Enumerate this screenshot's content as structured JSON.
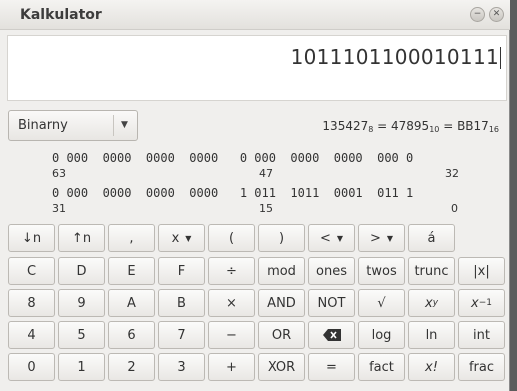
{
  "window": {
    "title": "Kalkulator",
    "minimize_icon": "minimize-icon",
    "close_icon": "close-icon"
  },
  "display": {
    "value": "1011101100010111"
  },
  "mode": {
    "selected": "Binarny"
  },
  "conversion": {
    "oct": "135427",
    "oct_base": "8",
    "dec": "47895",
    "dec_base": "10",
    "hex": "BB17",
    "hex_base": "16"
  },
  "bits": {
    "row1": "0 000  0000  0000  0000   0 000  0000  0000  000 0",
    "row1_left": "63",
    "row1_mid": "47",
    "row1_right": "32",
    "row2": "0 000  0000  0000  0000   1 011  1011  0001  011 1",
    "row2_left": "31",
    "row2_mid": "15",
    "row2_right": "0"
  },
  "keys": {
    "row1": [
      "↓n",
      "↑n",
      ",",
      "x",
      "(",
      ")",
      "<",
      ">",
      "á"
    ],
    "row2": [
      "C",
      "D",
      "E",
      "F",
      "÷",
      "mod",
      "ones",
      "twos",
      "trunc",
      "|x|"
    ],
    "row3": [
      "8",
      "9",
      "A",
      "B",
      "×",
      "AND",
      "NOT",
      "√",
      "x",
      "x"
    ],
    "row3_sup": {
      "pow": "y",
      "inv": "−1"
    },
    "row4": [
      "4",
      "5",
      "6",
      "7",
      "−",
      "OR",
      "",
      "log",
      "ln",
      "int"
    ],
    "row5": [
      "0",
      "1",
      "2",
      "3",
      "+",
      "XOR",
      "=",
      "fact",
      "x!",
      "frac"
    ]
  }
}
